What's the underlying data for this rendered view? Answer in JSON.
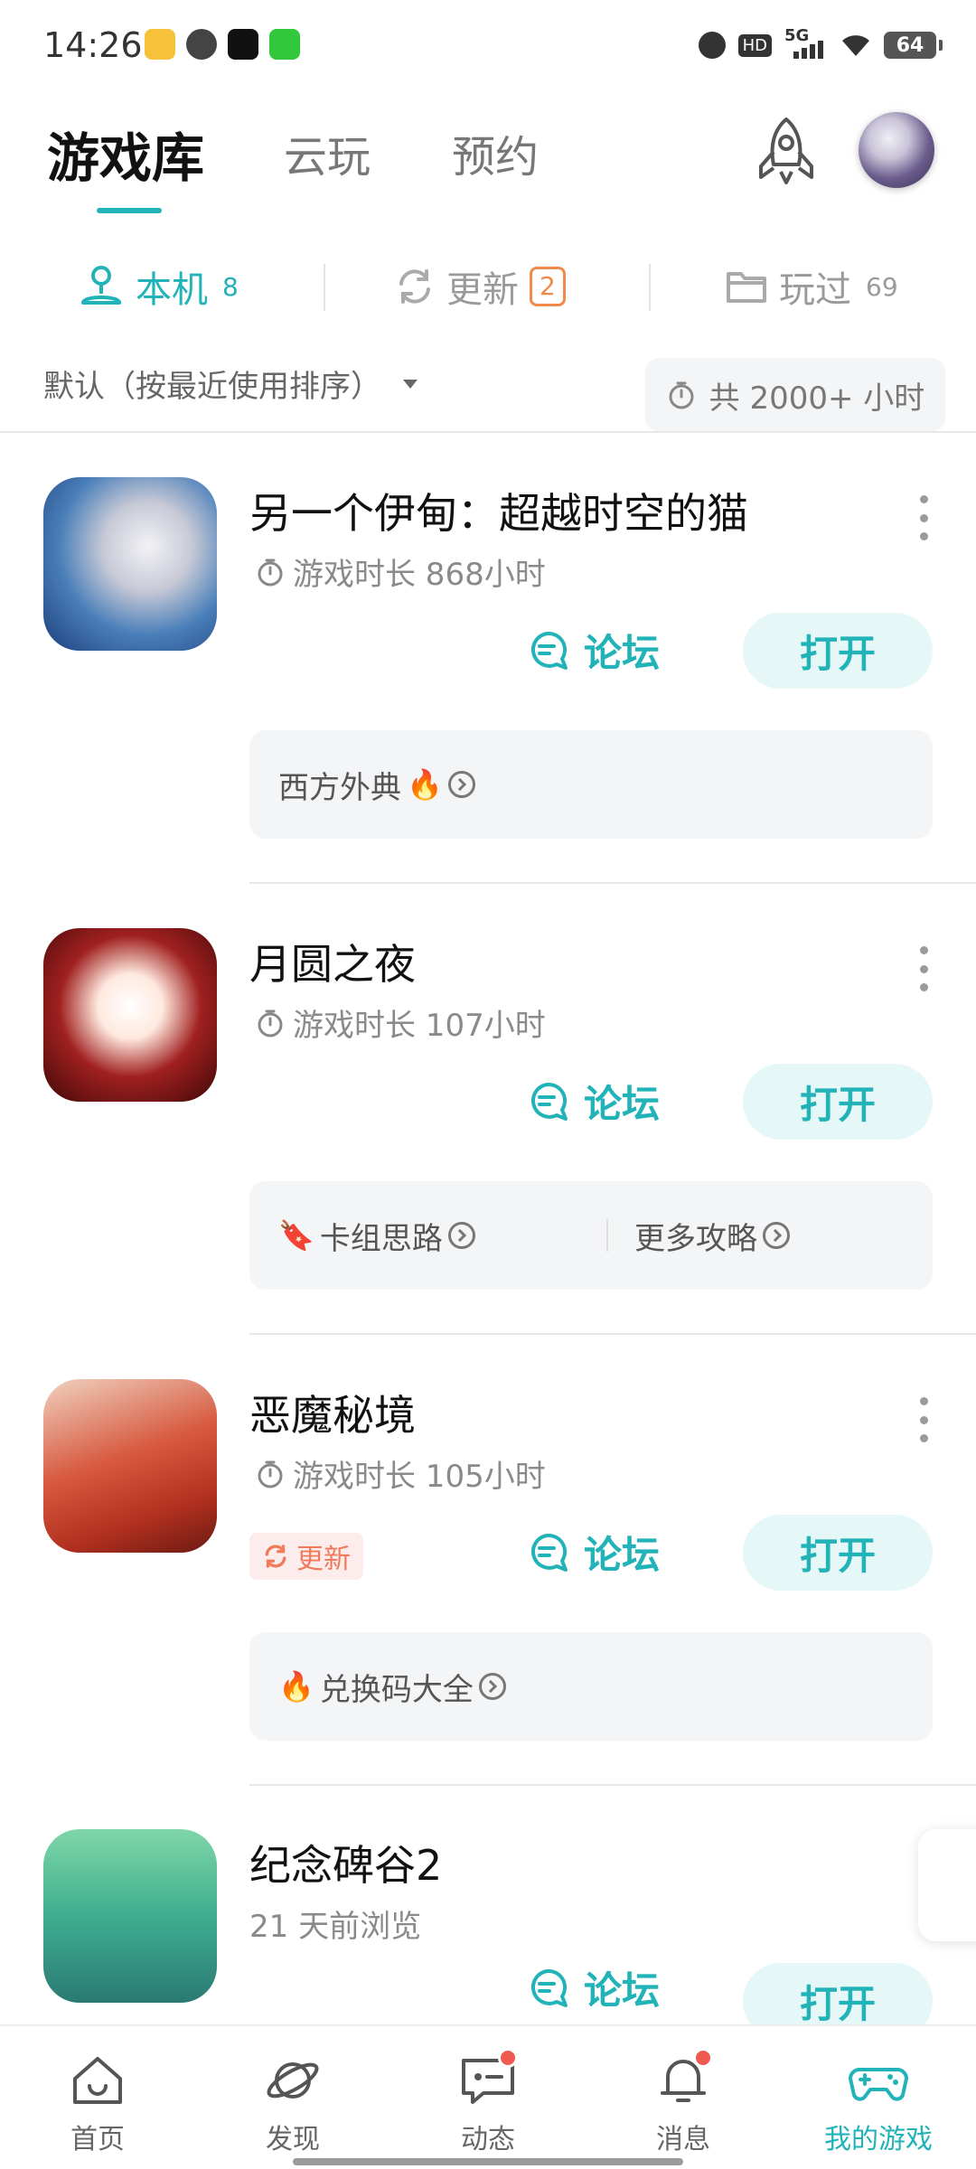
{
  "status_bar": {
    "time": "14:26",
    "network": "5G",
    "hd": "HD",
    "battery": "64"
  },
  "header": {
    "tabs": [
      {
        "label": "游戏库",
        "active": true
      },
      {
        "label": "云玩",
        "active": false
      },
      {
        "label": "预约",
        "active": false
      }
    ],
    "rocket_icon": "rocket-icon",
    "avatar": "user-avatar"
  },
  "sub_tabs": {
    "local": {
      "label": "本机",
      "count": "8"
    },
    "updates": {
      "label": "更新",
      "count": "2"
    },
    "played": {
      "label": "玩过",
      "count": "69"
    }
  },
  "sort": {
    "label": "默认（按最近使用排序）",
    "total_hours": "共 2000+ 小时"
  },
  "games": [
    {
      "title": "另一个伊甸：超越时空的猫",
      "subtitle": "游戏时长 868小时",
      "forum": "论坛",
      "open": "打开",
      "guides": [
        "西方外典"
      ]
    },
    {
      "title": "月圆之夜",
      "subtitle": "游戏时长 107小时",
      "forum": "论坛",
      "open": "打开",
      "guides": [
        "卡组思路",
        "更多攻略"
      ]
    },
    {
      "title": "恶魔秘境",
      "subtitle": "游戏时长 105小时",
      "update_tag": "更新",
      "forum": "论坛",
      "open": "打开",
      "guides": [
        "兑换码大全"
      ]
    },
    {
      "title": "纪念碑谷2",
      "subtitle": "21 天前浏览",
      "forum": "论坛",
      "open": "打开"
    }
  ],
  "bottom_nav": [
    {
      "label": "首页",
      "icon": "home-icon",
      "badge": false,
      "active": false
    },
    {
      "label": "发现",
      "icon": "planet-icon",
      "badge": false,
      "active": false
    },
    {
      "label": "动态",
      "icon": "chat-icon",
      "badge": true,
      "active": false
    },
    {
      "label": "消息",
      "icon": "bell-icon",
      "badge": true,
      "active": false
    },
    {
      "label": "我的游戏",
      "icon": "gamepad-icon",
      "badge": false,
      "active": true
    }
  ],
  "colors": {
    "accent": "#21b3b8",
    "badge_orange": "#f08a4b",
    "notification_red": "#f05a50",
    "open_button_bg": "#e6f7f7"
  }
}
